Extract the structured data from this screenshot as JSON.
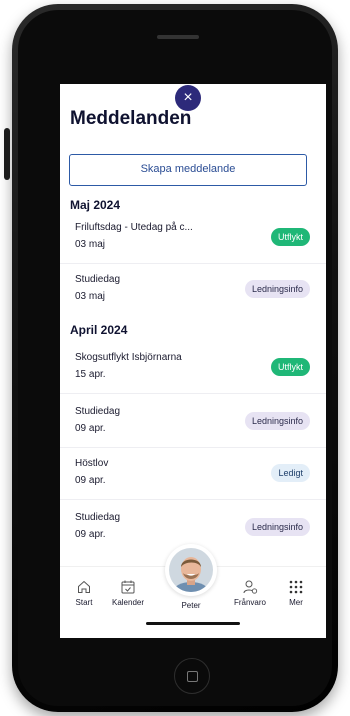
{
  "header": {
    "title": "Meddelanden",
    "close_glyph": "×"
  },
  "actions": {
    "create_label": "Skapa meddelande"
  },
  "sections": [
    {
      "label": "Maj 2024"
    },
    {
      "label": "April 2024"
    }
  ],
  "messages": [
    {
      "title": "Friluftsdag - Utedag på c...",
      "date": "03 maj",
      "badge": "Utflykt",
      "badge_style": "green"
    },
    {
      "title": "Studiedag",
      "date": "03 maj",
      "badge": "Ledningsinfo",
      "badge_style": "lavender"
    },
    {
      "title": "Skogsutflykt Isbjörnarna",
      "date": "15 apr.",
      "badge": "Utflykt",
      "badge_style": "green"
    },
    {
      "title": "Studiedag",
      "date": "09 apr.",
      "badge": "Ledningsinfo",
      "badge_style": "lavender"
    },
    {
      "title": "Höstlov",
      "date": "09 apr.",
      "badge": "Ledigt",
      "badge_style": "blue"
    },
    {
      "title": "Studiedag",
      "date": "09 apr.",
      "badge": "Ledningsinfo",
      "badge_style": "lavender"
    }
  ],
  "nav": {
    "start": "Start",
    "kalender": "Kalender",
    "peter": "Peter",
    "franvaro": "Frånvaro",
    "mer": "Mer"
  },
  "colors": {
    "accent": "#2d2a7a",
    "button_border": "#2d5aa6",
    "badge_green": "#1fb777",
    "badge_lavender": "#e7e3f3",
    "badge_blue": "#e3eef8"
  },
  "icons": {
    "close": "close-icon",
    "start": "home-icon",
    "kalender": "calendar-icon",
    "franvaro": "person-absence-icon",
    "mer": "grid-dots-icon"
  }
}
